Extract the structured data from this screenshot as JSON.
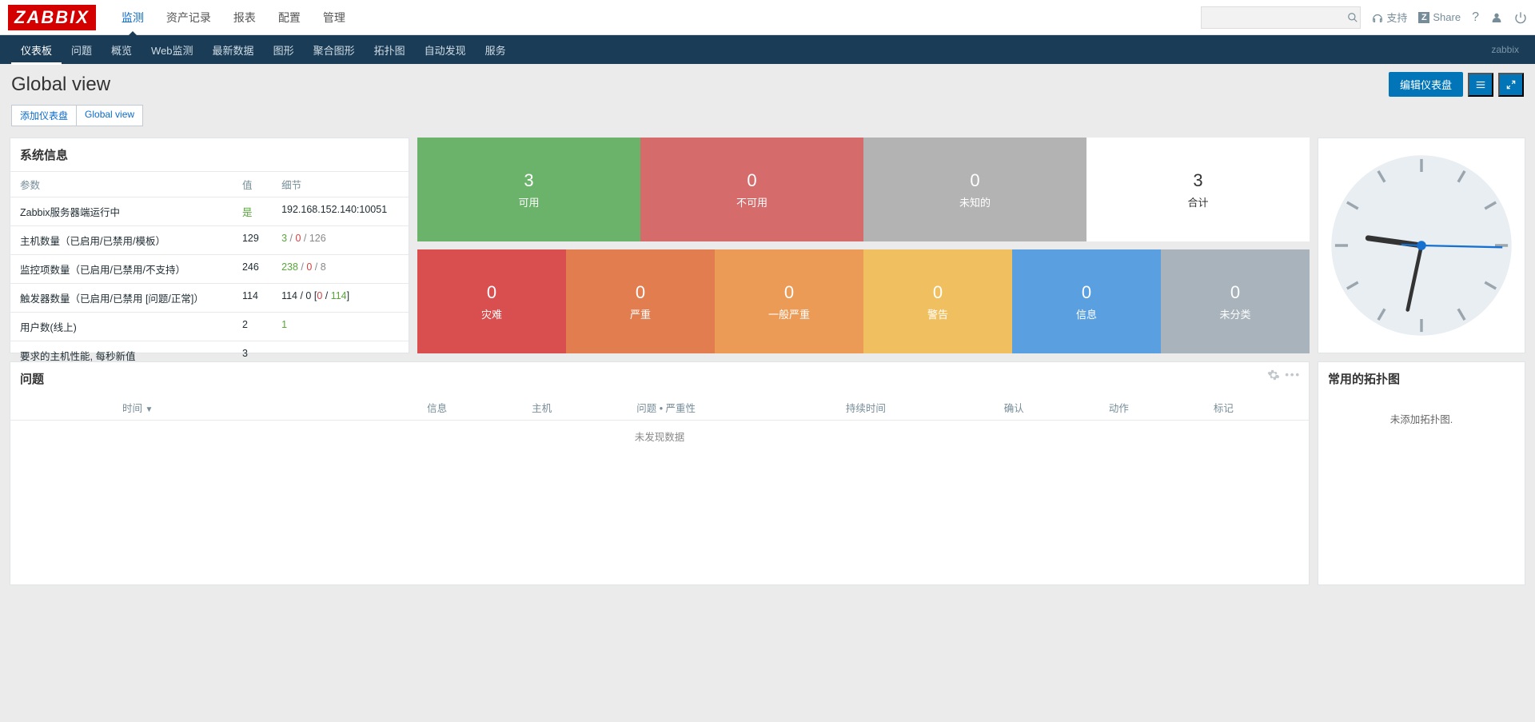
{
  "logo": "ZABBIX",
  "topnav": [
    "监测",
    "资产记录",
    "报表",
    "配置",
    "管理"
  ],
  "topnav_active": 0,
  "support_label": "支持",
  "share_label": "Share",
  "subnav": [
    "仪表板",
    "问题",
    "概览",
    "Web监测",
    "最新数据",
    "图形",
    "聚合图形",
    "拓扑图",
    "自动发现",
    "服务"
  ],
  "subnav_active": 0,
  "subnav_right": "zabbix",
  "page_title": "Global view",
  "edit_btn": "编辑仪表盘",
  "breadcrumb": [
    "添加仪表盘",
    "Global view"
  ],
  "sysinfo": {
    "title": "系统信息",
    "cols": [
      "参数",
      "值",
      "细节"
    ],
    "rows": [
      {
        "p": "Zabbix服务器端运行中",
        "v": "是",
        "v_cls": "green",
        "d_plain": "192.168.152.140:10051"
      },
      {
        "p": "主机数量（已启用/已禁用/模板）",
        "v": "129",
        "d_tri": [
          "3",
          "0",
          "126"
        ],
        "d_cls": [
          "green",
          "red",
          "grey"
        ]
      },
      {
        "p": "监控项数量（已启用/已禁用/不支持）",
        "v": "246",
        "d_tri": [
          "238",
          "0",
          "8"
        ],
        "d_cls": [
          "green",
          "red",
          "grey"
        ]
      },
      {
        "p": "触发器数量（已启用/已禁用 [问题/正常]）",
        "v": "114",
        "d_trig": [
          "114",
          "0",
          "0",
          "114"
        ]
      },
      {
        "p": "用户数(线上)",
        "v": "2",
        "d_plain": "1",
        "d_cls_single": "green"
      },
      {
        "p": "要求的主机性能, 每秒新值",
        "v": "3",
        "d_plain": ""
      }
    ]
  },
  "host_tiles": [
    {
      "num": "3",
      "label": "可用",
      "cls": "green1"
    },
    {
      "num": "0",
      "label": "不可用",
      "cls": "red1"
    },
    {
      "num": "0",
      "label": "未知的",
      "cls": "grey1"
    },
    {
      "num": "3",
      "label": "合计",
      "cls": "white"
    }
  ],
  "severity_tiles": [
    {
      "num": "0",
      "label": "灾难",
      "cls": "red2"
    },
    {
      "num": "0",
      "label": "严重",
      "cls": "orange1"
    },
    {
      "num": "0",
      "label": "一般严重",
      "cls": "orange2"
    },
    {
      "num": "0",
      "label": "警告",
      "cls": "yellow1"
    },
    {
      "num": "0",
      "label": "信息",
      "cls": "blue1"
    },
    {
      "num": "0",
      "label": "未分类",
      "cls": "grey2"
    }
  ],
  "problems": {
    "title": "问题",
    "cols": [
      "时间",
      "信息",
      "主机",
      "问题 • 严重性",
      "持续时间",
      "确认",
      "动作",
      "标记"
    ],
    "nodata": "未发现数据"
  },
  "maps": {
    "title": "常用的拓扑图",
    "empty": "未添加拓扑图."
  }
}
